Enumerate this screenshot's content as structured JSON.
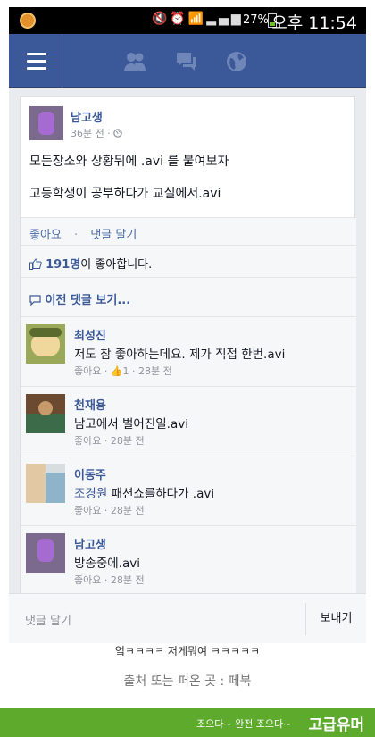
{
  "status_bar": {
    "battery": "27%",
    "time": "오후 11:54",
    "icons": [
      "mute-icon",
      "alarm-icon",
      "wifi-icon",
      "signal-icon",
      "battery-icon"
    ]
  },
  "navbar": {
    "background": "#3b5998",
    "icons": [
      "menu-icon",
      "friend-requests-icon",
      "messages-icon",
      "notifications-globe-icon"
    ]
  },
  "post": {
    "author": "남고생",
    "time": "36분 전 ·",
    "lines": [
      "모든장소와 상황뒤에 .avi 를 붙여보자",
      "고등학생이 공부하다가 교실에서.avi"
    ],
    "actions": {
      "like": "좋아요",
      "separator": "·",
      "comment": "댓글 달기"
    },
    "likes": {
      "count": "191명",
      "suffix": "이 좋아합니다."
    },
    "previous_comments": "이전 댓글 보기..."
  },
  "comments": [
    {
      "name": "최성진",
      "tag": "",
      "text": "저도 참 좋아하는데요. 제가 직접 한번.avi",
      "meta": "좋아요 · 👍1 · 28분 전"
    },
    {
      "name": "천재용",
      "tag": "",
      "text": "남고에서 벌어진일.avi",
      "meta": "좋아요 · 28분 전"
    },
    {
      "name": "이동주",
      "tag": "조경원",
      "text": " 패션쇼를하다가 .avi",
      "meta": "좋아요 · 28분 전"
    },
    {
      "name": "남고생",
      "tag": "",
      "text": "방송중에.avi",
      "meta": "좋아요 · 28분 전"
    }
  ],
  "reply_bar": {
    "placeholder": "댓글 달기",
    "send": "보내기"
  },
  "captions": {
    "line1": "엌ㅋㅋㅋㅋ 저게뭐여 ㅋㅋㅋㅋㅋ",
    "source": "출처 또는 퍼온 곳 : 페북"
  },
  "footer": {
    "small": "조으다~ 완전 조으다~",
    "brand": "고급유머",
    "color": "#5eaa2d"
  }
}
